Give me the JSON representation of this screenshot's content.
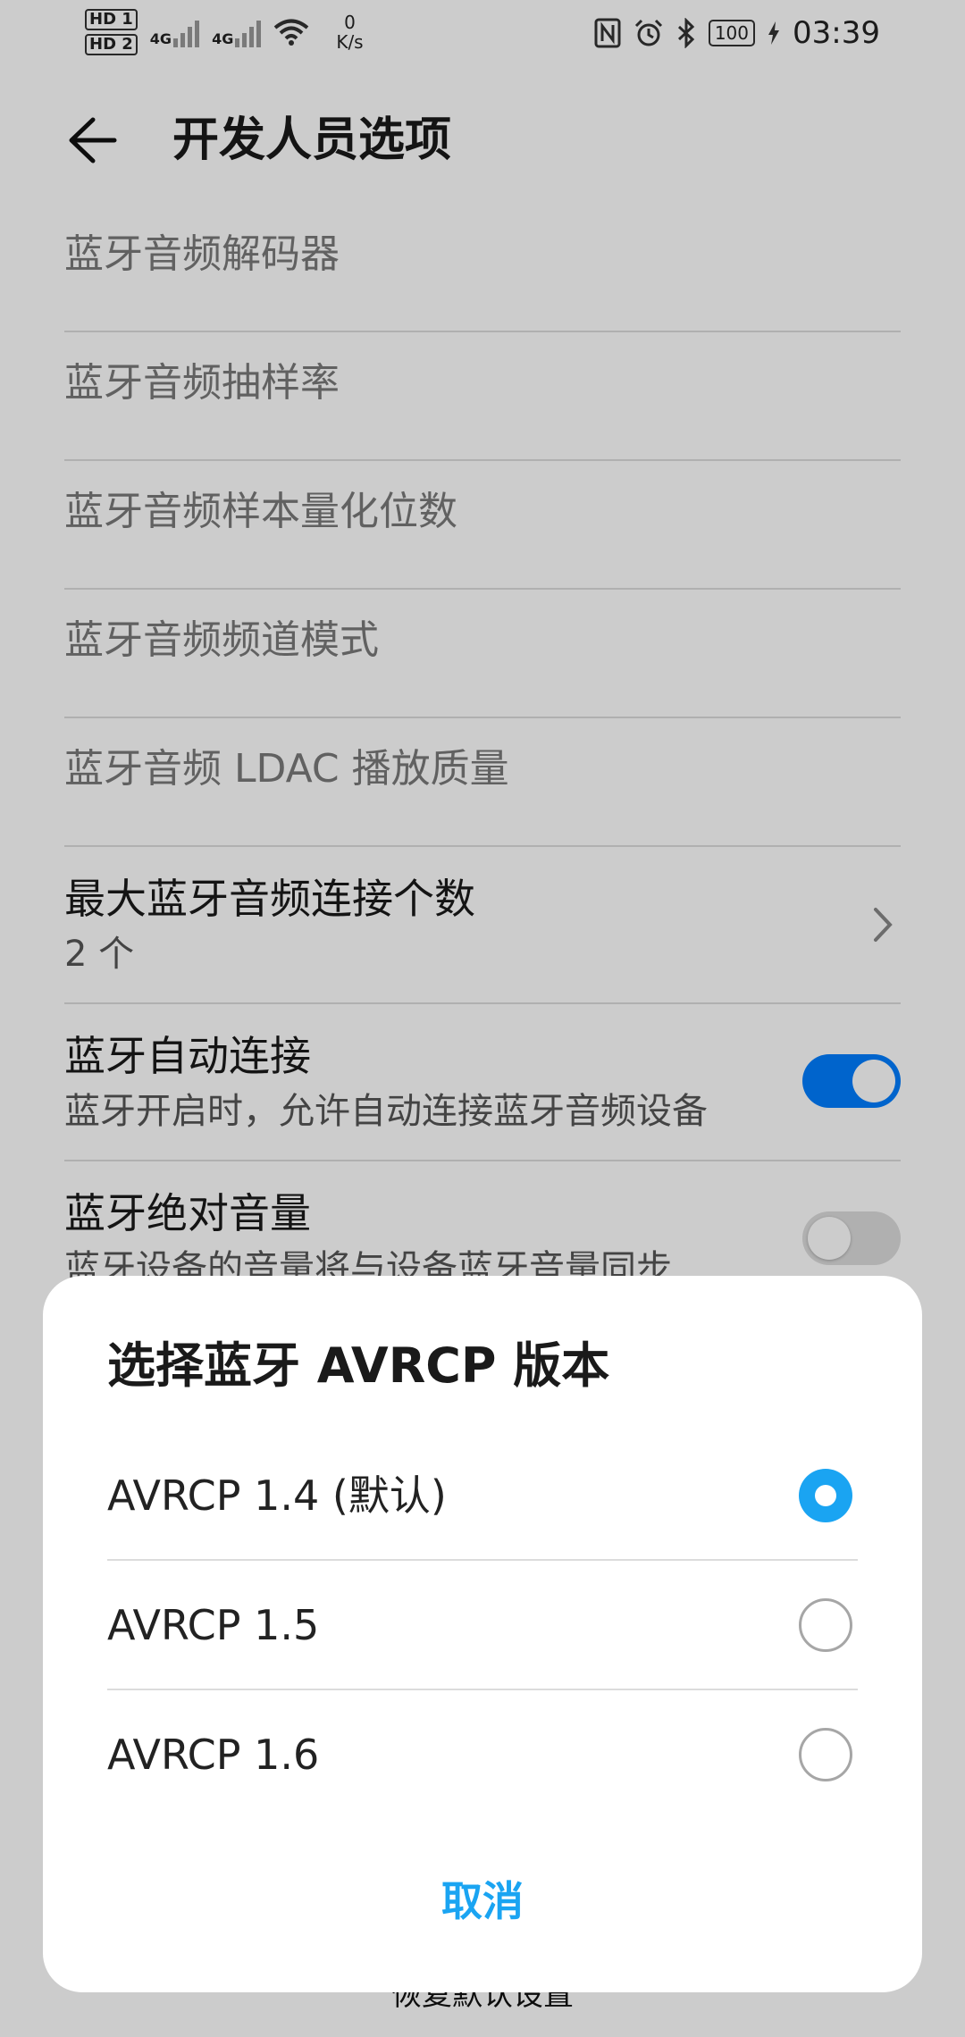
{
  "status_bar": {
    "hd1": "HD 1",
    "hd2": "HD 2",
    "sig1": "4G",
    "sig2": "4G",
    "speed_value": "0",
    "speed_unit": "K/s",
    "battery": "100",
    "time": "03:39"
  },
  "header": {
    "title": "开发人员选项"
  },
  "settings": {
    "items": [
      {
        "label": "蓝牙音频解码器"
      },
      {
        "label": "蓝牙音频抽样率"
      },
      {
        "label": "蓝牙音频样本量化位数"
      },
      {
        "label": "蓝牙音频频道模式"
      },
      {
        "label": "蓝牙音频 LDAC 播放质量"
      }
    ],
    "max_connections": {
      "title": "最大蓝牙音频连接个数",
      "value": "2 个"
    },
    "auto_connect": {
      "title": "蓝牙自动连接",
      "subtitle": "蓝牙开启时，允许自动连接蓝牙音频设备",
      "enabled": true
    },
    "absolute_volume": {
      "title": "蓝牙绝对音量",
      "subtitle": "蓝牙设备的音量将与设备蓝牙音量同步",
      "enabled": false
    },
    "reset_label": "恢复默认设置"
  },
  "dialog": {
    "title": "选择蓝牙 AVRCP 版本",
    "options": [
      {
        "label": "AVRCP 1.4 (默认)",
        "selected": true
      },
      {
        "label": "AVRCP 1.5",
        "selected": false
      },
      {
        "label": "AVRCP 1.6",
        "selected": false
      }
    ],
    "cancel_label": "取消"
  },
  "colors": {
    "accent": "#1aa4f2",
    "toggle_on": "#007dff",
    "scrim": "rgba(0,0,0,0.2)"
  }
}
